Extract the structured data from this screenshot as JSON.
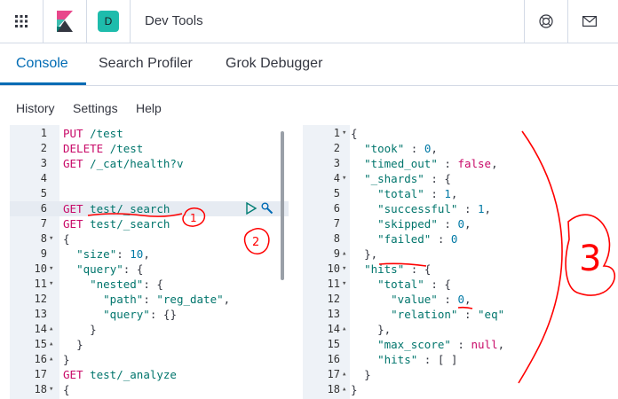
{
  "header": {
    "space_initial": "D",
    "title": "Dev Tools"
  },
  "tabs": [
    {
      "label": "Console",
      "active": true
    },
    {
      "label": "Search Profiler",
      "active": false
    },
    {
      "label": "Grok Debugger",
      "active": false
    }
  ],
  "menu": {
    "history": "History",
    "settings": "Settings",
    "help": "Help"
  },
  "colors": {
    "accent": "#006bb4",
    "space_badge": "#1ebcac",
    "annotation": "#ff0000"
  },
  "icons": [
    "apps-grid-icon",
    "kibana-logo-icon",
    "help-icon",
    "mail-icon",
    "play-icon",
    "wrench-icon"
  ],
  "request_editor": {
    "lines": [
      {
        "n": "1",
        "text": "PUT /test"
      },
      {
        "n": "2",
        "text": "DELETE /test"
      },
      {
        "n": "3",
        "text": "GET /_cat/health?v"
      },
      {
        "n": "4",
        "text": ""
      },
      {
        "n": "5",
        "text": ""
      },
      {
        "n": "6",
        "text": "GET test/_search",
        "active": true
      },
      {
        "n": "7",
        "text": "GET test/_search"
      },
      {
        "n": "8",
        "text": "{"
      },
      {
        "n": "9",
        "text": "  \"size\": 10,"
      },
      {
        "n": "10",
        "text": "  \"query\": {"
      },
      {
        "n": "11",
        "text": "    \"nested\": {"
      },
      {
        "n": "12",
        "text": "      \"path\": \"reg_date\","
      },
      {
        "n": "13",
        "text": "      \"query\": {}"
      },
      {
        "n": "14",
        "text": "    }"
      },
      {
        "n": "15",
        "text": "  }"
      },
      {
        "n": "16",
        "text": "}"
      },
      {
        "n": "17",
        "text": "GET test/_analyze"
      },
      {
        "n": "18",
        "text": "{"
      }
    ]
  },
  "response_output": {
    "lines": [
      {
        "n": "1",
        "text": "{"
      },
      {
        "n": "2",
        "text": "  \"took\" : 0,"
      },
      {
        "n": "3",
        "text": "  \"timed_out\" : false,"
      },
      {
        "n": "4",
        "text": "  \"_shards\" : {"
      },
      {
        "n": "5",
        "text": "    \"total\" : 1,"
      },
      {
        "n": "6",
        "text": "    \"successful\" : 1,"
      },
      {
        "n": "7",
        "text": "    \"skipped\" : 0,"
      },
      {
        "n": "8",
        "text": "    \"failed\" : 0"
      },
      {
        "n": "9",
        "text": "  },"
      },
      {
        "n": "10",
        "text": "  \"hits\" : {"
      },
      {
        "n": "11",
        "text": "    \"total\" : {"
      },
      {
        "n": "12",
        "text": "      \"value\" : 0,"
      },
      {
        "n": "13",
        "text": "      \"relation\" : \"eq\""
      },
      {
        "n": "14",
        "text": "    },"
      },
      {
        "n": "15",
        "text": "    \"max_score\" : null,"
      },
      {
        "n": "16",
        "text": "    \"hits\" : [ ]"
      },
      {
        "n": "17",
        "text": "  }"
      },
      {
        "n": "18",
        "text": "}"
      }
    ]
  },
  "annotations": {
    "one": "1",
    "two": "2",
    "three": "3"
  }
}
